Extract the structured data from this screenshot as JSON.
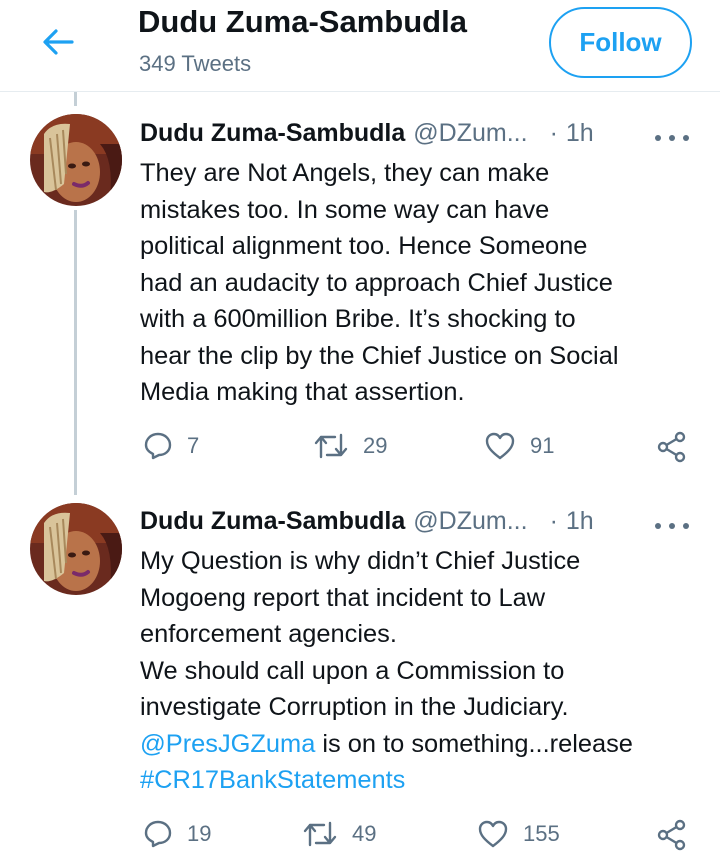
{
  "header": {
    "back_icon": "arrow-left-icon",
    "name": "Dudu Zuma-Sambudla",
    "tweet_count": "349 Tweets",
    "follow_label": "Follow"
  },
  "colors": {
    "accent": "#1da1f2",
    "secondary_text": "#5b7083",
    "divider": "#e6ecf0"
  },
  "tweets": [
    {
      "author_name": "Dudu Zuma-Sambudla",
      "handle": "@DZum...",
      "dot": "·",
      "time": "1h",
      "lines": [
        "They are Not Angels, they can make",
        "mistakes too. In some way can have",
        "political alignment too. Hence Someone",
        "had an audacity to approach Chief Justice",
        "with a 600million Bribe. It’s shocking to",
        "hear the clip by the Chief Justice on Social",
        "Media making that assertion."
      ],
      "replies": "7",
      "retweets": "29",
      "likes": "91"
    },
    {
      "author_name": "Dudu Zuma-Sambudla",
      "handle": "@DZum...",
      "dot": "·",
      "time": "1h",
      "lines": [
        "My Question is why didn’t Chief Justice",
        "Mogoeng report that incident to Law",
        "enforcement agencies.",
        "We should call upon a Commission to",
        "investigate Corruption in the Judiciary."
      ],
      "mention": "@PresJGZuma",
      "mention_rest": " is on to something...release",
      "hashtag": "#CR17BankStatements",
      "replies": "19",
      "retweets": "49",
      "likes": "155"
    }
  ],
  "icons": {
    "reply": "reply-icon",
    "retweet": "retweet-icon",
    "like": "heart-icon",
    "share": "share-icon",
    "more": "more-icon"
  }
}
